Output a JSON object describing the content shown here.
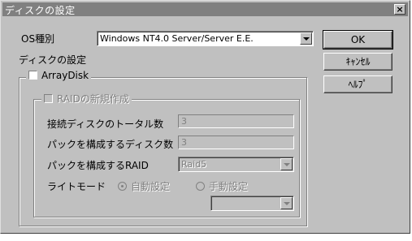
{
  "window": {
    "title": "ディスクの設定",
    "close_label": "×"
  },
  "os": {
    "label": "OS種別",
    "value": "Windows NT4.0 Server/Server E.E."
  },
  "disk_settings_label": "ディスクの設定",
  "array_disk": {
    "label": "ArrayDisk",
    "checked": false
  },
  "raid_create": {
    "label": "RAIDの新規作成",
    "checked": false,
    "disk_count_label": "接続ディスクのトータル数",
    "disk_count_value": "3",
    "pack_disks_label": "パックを構成するディスク数",
    "pack_disks_value": "3",
    "pack_raid_label": "パックを構成するRAID",
    "pack_raid_value": "Raid5",
    "write_mode_label": "ライトモード",
    "write_mode_auto": "自動設定",
    "write_mode_manual": "手動設定",
    "write_mode_selected": "auto",
    "manual_select_value": ""
  },
  "buttons": {
    "ok": "OK",
    "cancel": "ｷｬﾝｾﾙ",
    "help": "ﾍﾙﾌﾟ"
  }
}
